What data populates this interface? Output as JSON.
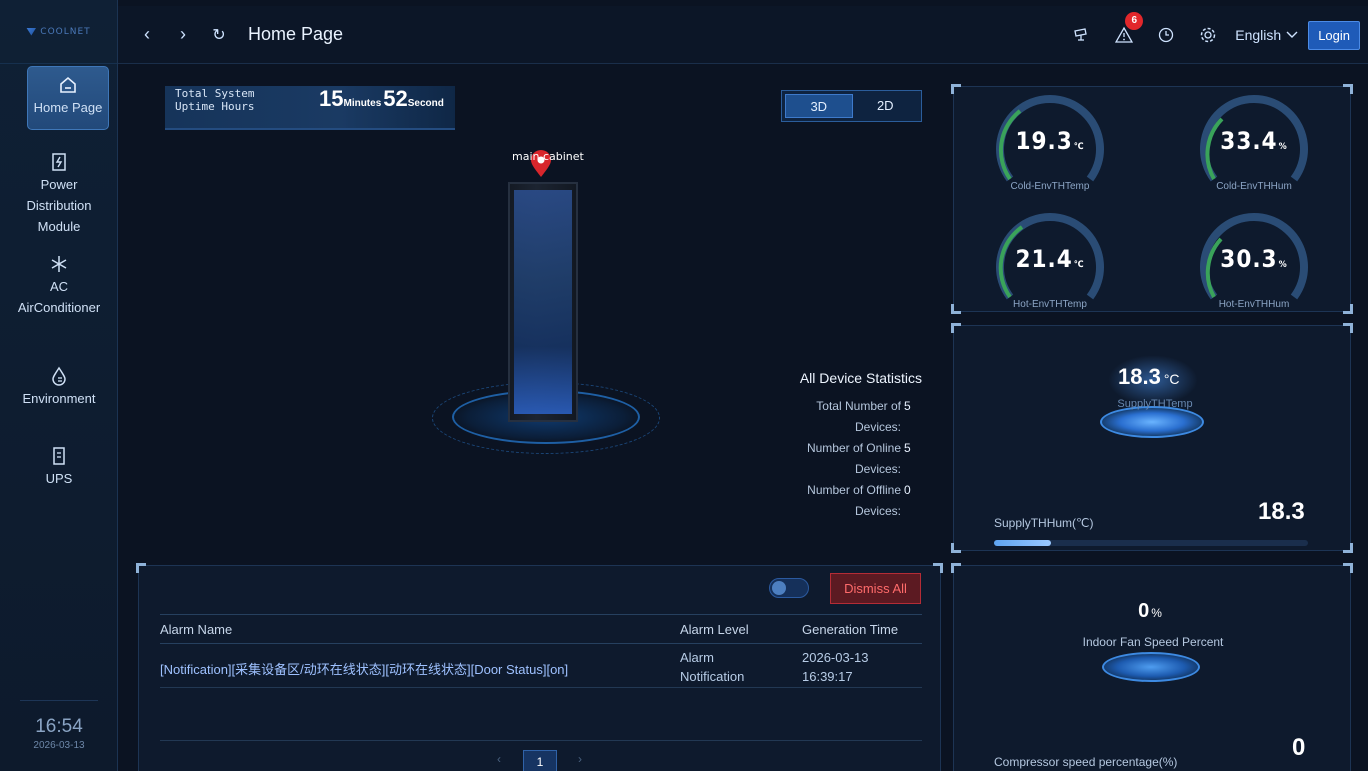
{
  "app": {
    "logo_text": "COOLNET"
  },
  "header": {
    "title": "Home Page",
    "alarm_badge": "6",
    "language": "English",
    "login_label": "Login"
  },
  "sidebar": {
    "items": [
      {
        "label": "Home Page",
        "icon": "home-icon"
      },
      {
        "label": "Power Distribution Module",
        "icon": "power-icon"
      },
      {
        "label": "AC AirConditioner",
        "icon": "snowflake-icon"
      },
      {
        "label": "Environment",
        "icon": "droplet-icon"
      },
      {
        "label": "UPS",
        "icon": "ups-icon"
      }
    ],
    "time": "16:54",
    "date": "2026-03-13"
  },
  "uptime": {
    "label": "Total System Uptime Hours",
    "minutes": "15",
    "minutes_unit": "Minutes",
    "seconds": "52",
    "seconds_unit": "Second"
  },
  "view_toggle": {
    "options": [
      "3D",
      "2D"
    ],
    "selected": "3D"
  },
  "cabinet": {
    "label": "main cabinet"
  },
  "stats": {
    "title": "All Device Statistics",
    "rows": [
      {
        "label": "Total Number of Devices:",
        "value": "5"
      },
      {
        "label": "Number of Online Devices:",
        "value": "5"
      },
      {
        "label": "Number of Offline Devices:",
        "value": "0"
      }
    ]
  },
  "gauges": [
    {
      "value": "19.3",
      "unit": "℃",
      "label": "Cold-EnvTHTemp",
      "accent": "#3aa35a"
    },
    {
      "value": "33.4",
      "unit": "%",
      "label": "Cold-EnvTHHum",
      "accent": "#3aa35a"
    },
    {
      "value": "21.4",
      "unit": "℃",
      "label": "Hot-EnvTHTemp",
      "accent": "#3aa35a"
    },
    {
      "value": "30.3",
      "unit": "%",
      "label": "Hot-EnvTHHum",
      "accent": "#3aa35a"
    }
  ],
  "supply": {
    "temp_value": "18.3",
    "temp_unit": "°C",
    "temp_label": "SupplyTHTemp",
    "hum_label": "SupplyTHHum(℃)",
    "hum_value": "18.3",
    "hum_fraction": 0.183
  },
  "fan": {
    "indoor_value": "0",
    "indoor_unit": "%",
    "indoor_label": "Indoor Fan Speed Percent",
    "compressor_label": "Compressor speed percentage(%)",
    "compressor_value": "0"
  },
  "alarms": {
    "dismiss_label": "Dismiss All",
    "columns": [
      "Alarm Name",
      "Alarm Level",
      "Generation Time"
    ],
    "rows": [
      {
        "name": "[Notification][采集设备区/动环在线状态][动环在线状态][Door Status][on]",
        "level": "Alarm Notification",
        "time": "2026-03-13 16:39:17"
      }
    ],
    "page": "1"
  },
  "colors": {
    "accent": "#1f5bb8",
    "danger": "#e2272b",
    "background": "#0b1322"
  }
}
